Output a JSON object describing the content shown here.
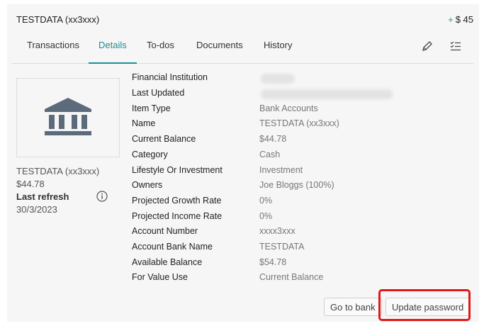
{
  "header": {
    "title": "TESTDATA (xx3xxx)",
    "change_sign": "+",
    "change_amount": "$ 45"
  },
  "tabs": [
    {
      "label": "Transactions"
    },
    {
      "label": "Details",
      "active": true
    },
    {
      "label": "To-dos"
    },
    {
      "label": "Documents"
    },
    {
      "label": "History"
    }
  ],
  "toolbar_icons": [
    "pencil-icon",
    "checklist-icon"
  ],
  "sidebar": {
    "icon": "bank-icon",
    "name": "TESTDATA (xx3xxx)",
    "balance": "$44.78",
    "last_refresh_label": "Last refresh",
    "last_refresh_date": "30/3/2023"
  },
  "details": [
    {
      "label": "Financial Institution",
      "value": ""
    },
    {
      "label": "Last Updated",
      "value": ""
    },
    {
      "label": "Item Type",
      "value": "Bank Accounts"
    },
    {
      "label": "Name",
      "value": "TESTDATA (xx3xxx)"
    },
    {
      "label": "Current Balance",
      "value": "$44.78"
    },
    {
      "label": "Category",
      "value": "Cash"
    },
    {
      "label": "Lifestyle Or Investment",
      "value": "Investment"
    },
    {
      "label": "Owners",
      "value": "Joe Bloggs (100%)"
    },
    {
      "label": "Projected Growth Rate",
      "value": "0%"
    },
    {
      "label": "Projected Income Rate",
      "value": "0%"
    },
    {
      "label": "Account Number",
      "value": "xxxx3xxx"
    },
    {
      "label": "Account Bank Name",
      "value": "TESTDATA"
    },
    {
      "label": "Available Balance",
      "value": "$54.78"
    },
    {
      "label": "For Value Use",
      "value": "Current Balance"
    }
  ],
  "buttons": {
    "go_to_bank": "Go to bank",
    "update_password": "Update password"
  },
  "colors": {
    "accent": "#1b8f8f",
    "positive": "#2e9b6a",
    "highlight": "#e01818",
    "icon": "#5b6b7b"
  }
}
